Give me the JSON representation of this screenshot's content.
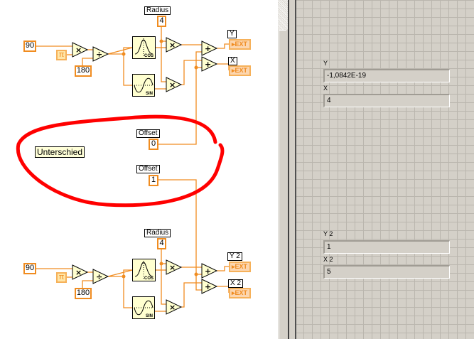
{
  "diagram": {
    "top": {
      "angle_const": "90",
      "pi_const": "π",
      "deg_const": "180",
      "radius_label": "Radius",
      "radius_value": "4",
      "cos_label": "COS",
      "sin_label": "SIN",
      "y_label": "Y",
      "x_label": "X",
      "y_type": "▸EXT",
      "x_type": "▸EXT",
      "mul_symbol": "×",
      "div_symbol": "÷",
      "add_symbol": "+"
    },
    "offset_top": {
      "label": "Offset",
      "value": "0"
    },
    "offset_bottom": {
      "label": "Offset",
      "value": "1"
    },
    "note": "Unterschied",
    "bottom": {
      "angle_const": "90",
      "pi_const": "π",
      "deg_const": "180",
      "radius_label": "Radius",
      "radius_value": "4",
      "cos_label": "COS",
      "sin_label": "SIN",
      "y_label": "Y 2",
      "x_label": "X 2",
      "y_type": "▸EXT",
      "x_type": "▸EXT",
      "mul_symbol": "×",
      "div_symbol": "÷",
      "add_symbol": "+"
    }
  },
  "panel": {
    "indicators": [
      {
        "label": "Y",
        "value": "-1,0842E-19"
      },
      {
        "label": "X",
        "value": "4"
      },
      {
        "label": "Y 2",
        "value": "1"
      },
      {
        "label": "X 2",
        "value": "5"
      }
    ]
  },
  "colors": {
    "wire": "#f08c20",
    "annotation": "#ff0000",
    "panel": "#d4d0c8"
  }
}
